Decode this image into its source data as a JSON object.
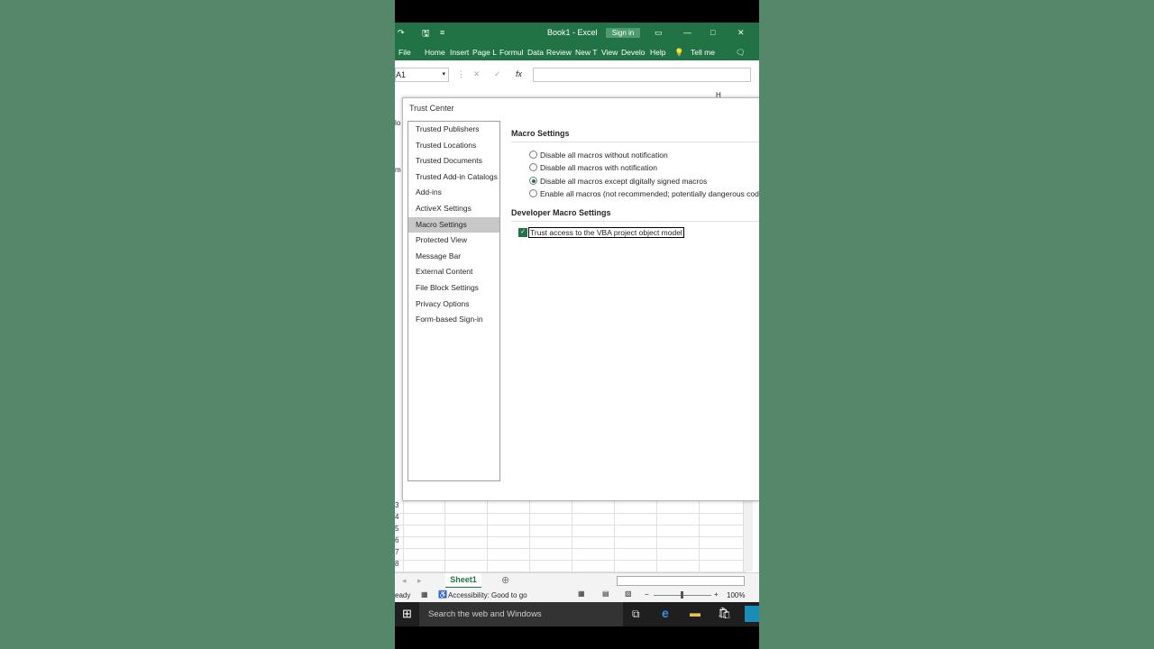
{
  "window": {
    "title": "Book1 - Excel",
    "sign_in_label": "Sign in",
    "ribbon_tabs": [
      "File",
      "Home",
      "Insert",
      "Page L",
      "Formul",
      "Data",
      "Review",
      "New T",
      "View",
      "Develo",
      "Help",
      "Tell me"
    ],
    "name_box_value": "A1"
  },
  "dialog": {
    "title": "Trust Center",
    "nav_items": [
      "Trusted Publishers",
      "Trusted Locations",
      "Trusted Documents",
      "Trusted Add-in Catalogs",
      "Add-ins",
      "ActiveX Settings",
      "Macro Settings",
      "Protected View",
      "Message Bar",
      "External Content",
      "File Block Settings",
      "Privacy Options",
      "Form-based Sign-in"
    ],
    "active_nav": "Macro Settings",
    "macro_section_title": "Macro Settings",
    "macro_options": [
      "Disable all macros without notification",
      "Disable all macros with notification",
      "Disable all macros except digitally signed macros",
      "Enable all macros (not recommended; potentially dangerous code can"
    ],
    "selected_macro_option_index": 2,
    "developer_section_title": "Developer Macro Settings",
    "vba_checkbox_label": "Trust access to the VBA project object model",
    "vba_checked": true
  },
  "sheet": {
    "tab_label": "Sheet1",
    "row_numbers": [
      "3",
      "4",
      "5",
      "6",
      "7",
      "8"
    ]
  },
  "status": {
    "ready": "eady",
    "accessibility": "Accessibility: Good to go",
    "zoom": "100%"
  },
  "taskbar": {
    "search_placeholder": "Search the web and Windows"
  },
  "colors": {
    "excel_green": "#217346",
    "background": "#55876b"
  }
}
